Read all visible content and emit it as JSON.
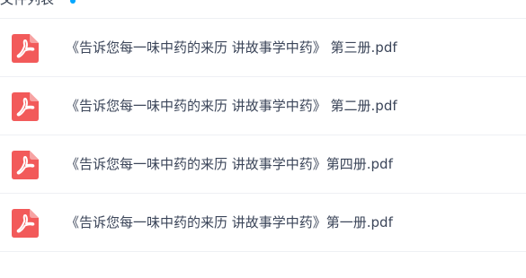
{
  "colors": {
    "pdf_icon": "#f25a5a",
    "text": "#3b4559",
    "divider": "#eef0f4",
    "accent_dot": "#06a7ff"
  },
  "top_fragment": {
    "text": "文件列表"
  },
  "files": [
    {
      "name": "《告诉您每一味中药的来历 讲故事学中药》 第三册.pdf",
      "icon": "pdf-icon"
    },
    {
      "name": "《告诉您每一味中药的来历 讲故事学中药》 第二册.pdf",
      "icon": "pdf-icon"
    },
    {
      "name": "《告诉您每一味中药的来历 讲故事学中药》第四册.pdf",
      "icon": "pdf-icon"
    },
    {
      "name": "《告诉您每一味中药的来历 讲故事学中药》第一册.pdf",
      "icon": "pdf-icon"
    }
  ]
}
